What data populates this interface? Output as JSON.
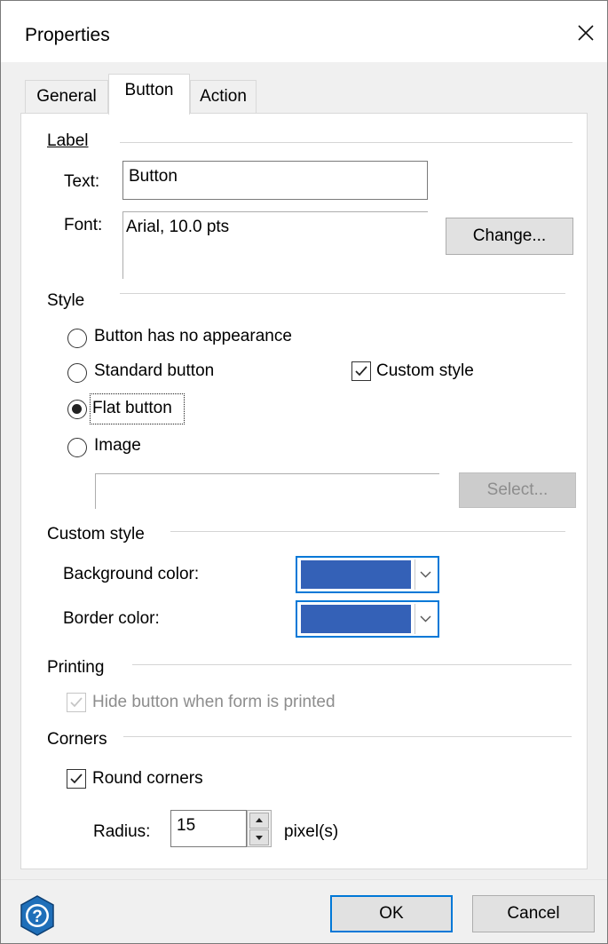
{
  "window": {
    "title": "Properties"
  },
  "tabs": [
    {
      "label": "General",
      "active": false
    },
    {
      "label": "Button",
      "active": true
    },
    {
      "label": "Action",
      "active": false
    }
  ],
  "label_group": {
    "title": "Label",
    "text_label": "Text:",
    "text_value": "Button",
    "font_label": "Font:",
    "font_value": "Arial, 10.0 pts",
    "change_button": "Change..."
  },
  "style_group": {
    "title": "Style",
    "no_appearance": "Button has no appearance",
    "standard": "Standard button",
    "flat": "Flat button",
    "image": "Image",
    "selected": "Flat button",
    "custom_style_checkbox": "Custom style",
    "custom_style_checked": true,
    "image_path": "",
    "select_button": "Select..."
  },
  "custom_style_group": {
    "title": "Custom style",
    "background_label": "Background color:",
    "background_color": "#3461b7",
    "border_label": "Border color:",
    "border_color": "#3461b7"
  },
  "printing_group": {
    "title": "Printing",
    "hide_label": "Hide button when form is printed",
    "hide_checked": true,
    "hide_disabled": true
  },
  "corners_group": {
    "title": "Corners",
    "round_label": "Round corners",
    "round_checked": true,
    "radius_label": "Radius:",
    "radius_value": "15",
    "radius_unit": "pixel(s)"
  },
  "footer": {
    "help_icon": "help-icon",
    "ok_button": "OK",
    "cancel_button": "Cancel"
  },
  "colors": {
    "accent": "#0078d7",
    "swatch": "#3461b7"
  }
}
